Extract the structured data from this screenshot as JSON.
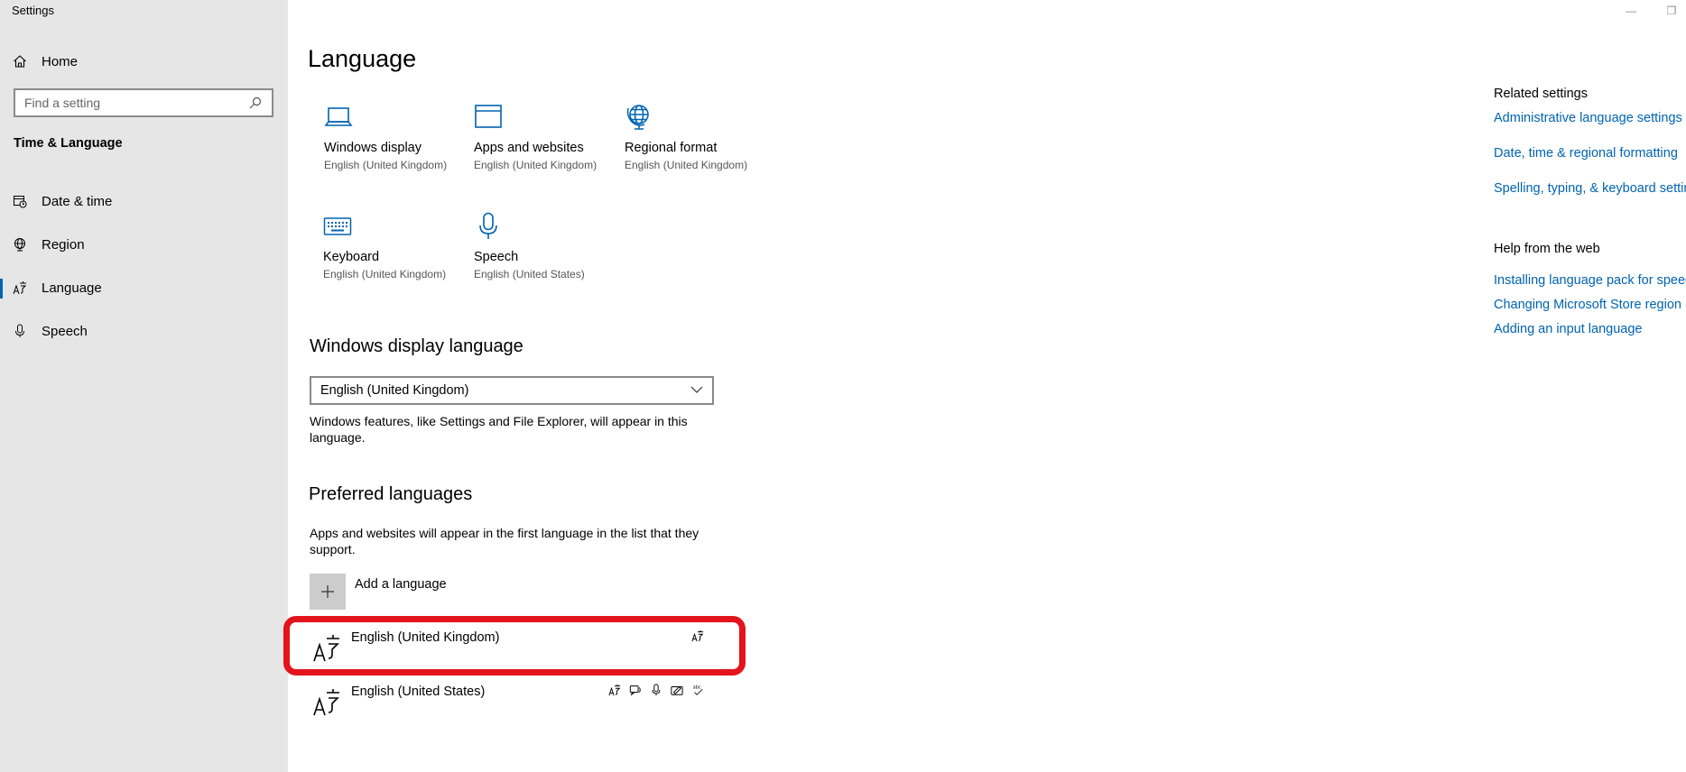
{
  "window": {
    "title": "Settings",
    "minimize_glyph": "—",
    "restore_glyph": "❐"
  },
  "sidebar": {
    "home_label": "Home",
    "search_placeholder": "Find a setting",
    "section_title": "Time & Language",
    "items": [
      {
        "label": "Date & time",
        "icon": "calendar-clock-icon"
      },
      {
        "label": "Region",
        "icon": "globe-icon"
      },
      {
        "label": "Language",
        "icon": "language-icon",
        "active": true
      },
      {
        "label": "Speech",
        "icon": "microphone-icon"
      }
    ]
  },
  "main": {
    "title": "Language",
    "tiles": [
      {
        "name": "Windows display",
        "value": "English (United Kingdom)",
        "icon": "laptop-icon"
      },
      {
        "name": "Apps and websites",
        "value": "English (United Kingdom)",
        "icon": "browser-window-icon"
      },
      {
        "name": "Regional format",
        "value": "English (United Kingdom)",
        "icon": "globe-icon"
      },
      {
        "name": "Keyboard",
        "value": "English (United Kingdom)",
        "icon": "keyboard-icon"
      },
      {
        "name": "Speech",
        "value": "English (United States)",
        "icon": "microphone-icon"
      }
    ],
    "display_language": {
      "heading": "Windows display language",
      "selected": "English (United Kingdom)",
      "description_line1": "Windows features, like Settings and File Explorer, will appear in this",
      "description_line2": "language."
    },
    "preferred": {
      "heading": "Preferred languages",
      "description_line1": "Apps and websites will appear in the first language in the list that they",
      "description_line2": "support.",
      "add_label": "Add a language",
      "languages": [
        {
          "name": "English (United Kingdom)",
          "features": [
            "display-language-icon"
          ]
        },
        {
          "name": "English (United States)",
          "features": [
            "display-language-icon",
            "text-to-speech-icon",
            "microphone-icon",
            "handwriting-icon",
            "spellcheck-icon"
          ]
        }
      ]
    }
  },
  "related": {
    "title": "Related settings",
    "links": [
      "Administrative language settings",
      "Date, time & regional formatting",
      "Spelling, typing, & keyboard settings"
    ]
  },
  "help": {
    "title": "Help from the web",
    "links": [
      "Installing language pack for speech",
      "Changing Microsoft Store region",
      "Adding an input language"
    ]
  },
  "colors": {
    "accent": "#0063b1",
    "sidebar_bg": "#e6e6e6",
    "highlight": "#e3141c"
  }
}
